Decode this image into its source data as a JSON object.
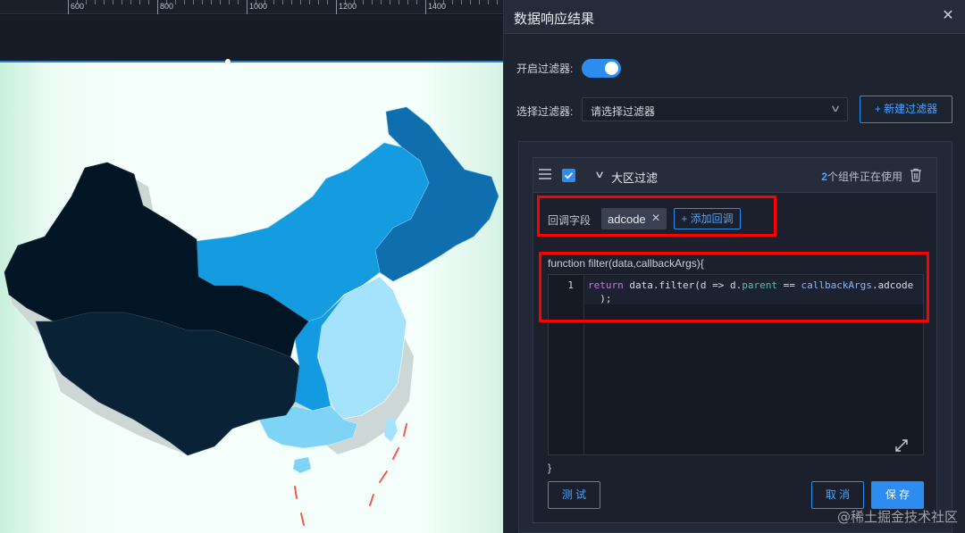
{
  "ruler": {
    "labels": [
      "600",
      "800",
      "1000",
      "1200",
      "1400"
    ]
  },
  "panel": {
    "title": "数据响应结果",
    "enable_filter_label": "开启过滤器:",
    "enable_filter_on": true,
    "select_filter_label": "选择过滤器:",
    "select_placeholder": "请选择过滤器",
    "new_filter_button": "+ 新建过滤器"
  },
  "filter_card": {
    "title": "大区过滤",
    "checked": true,
    "usage_count": "2",
    "usage_suffix": "个组件正在使用",
    "callback_field_label": "回调字段",
    "callback_tags": [
      "adcode"
    ],
    "add_callback_button": "+ 添加回调",
    "function_header": "function filter(data,callbackArgs){",
    "function_footer": "}",
    "code_line_number": "1",
    "code_text": "return data.filter(d => d.parent == callbackArgs.adcode\n  );",
    "test_button": "测 试",
    "cancel_button": "取 消",
    "save_button": "保 存"
  },
  "watermark": "@稀土掘金技术社区",
  "colors": {
    "accent": "#2d8cf0",
    "highlight_box": "#ff0000",
    "map_darkest": "#021524",
    "map_dark": "#0a2236",
    "map_mid": "#0f6fae",
    "map_blue": "#159bdf",
    "map_light": "#a5e2fb",
    "canvas_bg": "#f4fffb"
  }
}
